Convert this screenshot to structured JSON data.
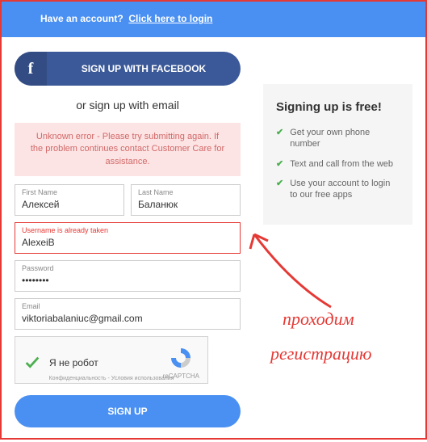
{
  "banner": {
    "prompt": "Have an account?",
    "link": "Click here to login"
  },
  "facebook": {
    "label": "SIGN UP WITH FACEBOOK",
    "icon": "f"
  },
  "or_text": "or sign up with email",
  "error_message": "Unknown error - Please try submitting again. If the problem continues contact Customer Care for assistance.",
  "fields": {
    "first_name": {
      "label": "First Name",
      "value": "Алексей"
    },
    "last_name": {
      "label": "Last Name",
      "value": "Баланюк"
    },
    "username": {
      "label": "Username is already taken",
      "value": "AlexeiB"
    },
    "password": {
      "label": "Password",
      "value": "••••••••"
    },
    "email": {
      "label": "Email",
      "value": "viktoriabalaniuc@gmail.com"
    }
  },
  "recaptcha": {
    "text": "Я не робот",
    "brand": "reCAPTCHA",
    "footer": "Конфиденциальность - Условия использования"
  },
  "signup_button": "SIGN UP",
  "sidebar": {
    "title": "Signing up is free!",
    "benefits": [
      "Get your own phone number",
      "Text and call from the web",
      "Use your account to login to our free apps"
    ]
  },
  "annotations": {
    "line1": "проходим",
    "line2": "регистрацию"
  }
}
